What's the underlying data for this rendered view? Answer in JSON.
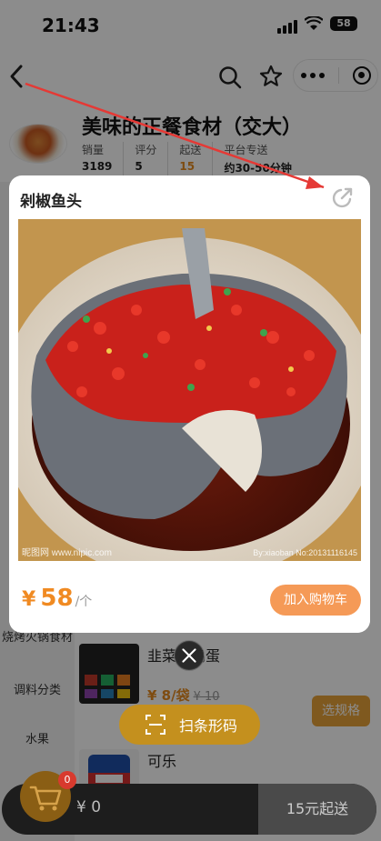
{
  "status": {
    "time": "21:43",
    "battery": "58"
  },
  "nav": {
    "back_icon": "back-chevron-icon",
    "search_icon": "search-icon",
    "star_icon": "star-icon"
  },
  "shop": {
    "name": "美味的正餐食材（交大）",
    "stats": [
      {
        "label": "销量",
        "value": "3189"
      },
      {
        "label": "评分",
        "value": "5"
      },
      {
        "label": "起送",
        "value": "15"
      },
      {
        "label": "平台专送",
        "value": "约30-50分钟"
      }
    ]
  },
  "categories": [
    "烧烤火锅食材",
    "调料分类",
    "水果"
  ],
  "items": [
    {
      "title": "韭菜炒鸡蛋",
      "price": "¥ 8/袋",
      "old_price": "¥ 10",
      "spec": "选规格"
    },
    {
      "title": "可乐",
      "price": "",
      "old_price": "",
      "spec": ""
    }
  ],
  "modal": {
    "title": "剁椒鱼头",
    "price_currency": "¥",
    "price_value": "58",
    "price_unit": "/个",
    "add_to_cart": "加入购物车",
    "watermark_left": "昵图网 www.nipic.com",
    "watermark_right": "By:xiaoban No:20131116145"
  },
  "scan_button": {
    "label": "扫条形码"
  },
  "cart": {
    "badge": "0",
    "total": "¥ 0",
    "min_order": "15元起送"
  },
  "colors": {
    "accent": "#e58a1f",
    "add_cart": "#f59a57",
    "scan": "#c4901e",
    "arrow": "#e53935"
  }
}
